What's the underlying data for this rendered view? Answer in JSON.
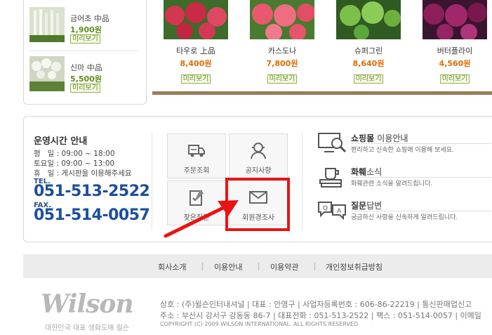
{
  "side_products": [
    {
      "name": "금어초 中品",
      "price": "1,900원",
      "button": "미리보기"
    },
    {
      "name": "신마 中品",
      "price": "5,500원",
      "button": "미리보기"
    }
  ],
  "products": [
    {
      "name": "타우로 上品",
      "price": "8,400원",
      "button": "미리보기",
      "color": "#d4364f"
    },
    {
      "name": "카스도나",
      "price": "7,800원",
      "button": "미리보기",
      "color": "#e8596f"
    },
    {
      "name": "슈퍼그린",
      "price": "8,640원",
      "button": "미리보기",
      "color": "#5aa83a"
    },
    {
      "name": "버터플라이",
      "price": "4,560원",
      "button": "미리보기",
      "color": "#8c1f5a"
    }
  ],
  "hours": {
    "title": "운영시간 안내",
    "lines": [
      "평   일 : 09:00 ~ 18:00",
      "토요일 : 09:00 ~ 13:00",
      "휴   일 : 게시판을 이용해주세요"
    ],
    "tel_label": "TEL.",
    "tel": "051-513-2522",
    "fax_label": "FAX.",
    "fax": "051-514-0057"
  },
  "quick_links": [
    {
      "label": "주문조회",
      "icon": "truck-icon"
    },
    {
      "label": "공지사항",
      "icon": "person-icon"
    },
    {
      "label": "잦은질문",
      "icon": "checklist-icon"
    },
    {
      "label": "회원경조사",
      "icon": "envelope-icon"
    }
  ],
  "guides": [
    {
      "title_bold": "쇼핑몰",
      "title_light": " 이용안내",
      "desc": "편리하고 신속한 쇼핑에 이용해 보세요.",
      "icon": "monitor-search-icon"
    },
    {
      "title_bold": "화훼",
      "title_light": "소식",
      "desc": "화훼관련 소식을 알려드립니다.",
      "icon": "coffee-books-icon"
    },
    {
      "title_bold": "질문",
      "title_light": "답변",
      "desc": "궁금하신 사항을 신속하게 알려드립니다.",
      "icon": "chat-bubbles-icon"
    }
  ],
  "footer_nav": [
    "회사소개",
    "이용안내",
    "이용약관",
    "개인정보취급방침"
  ],
  "footer": {
    "logo": "Wilson",
    "tagline": "대한민국 대표 생화도매 윌슨",
    "line1": "상호 : (주)윌슨인터내셔널  |  대표 : 안영구  |  사업자등록번호 : 606-86-22219  |  통신판매업신고",
    "line2": "주소 : 부산시 강서구 강동동 86-7  |  대표전화 : 051-513-2522  |  팩스 : 051-514-0057  |  이메일",
    "copyright": "COPYRIGHT (C) 2009 WILSON INTERNATIONAL. ALL RIGHTS RESERVED"
  },
  "colors": {
    "highlight": "#e81414",
    "arrow": "#e81414",
    "tel_blue": "#1c4f9c",
    "price_orange": "#e06a00",
    "price_green": "#5e8d1a"
  }
}
